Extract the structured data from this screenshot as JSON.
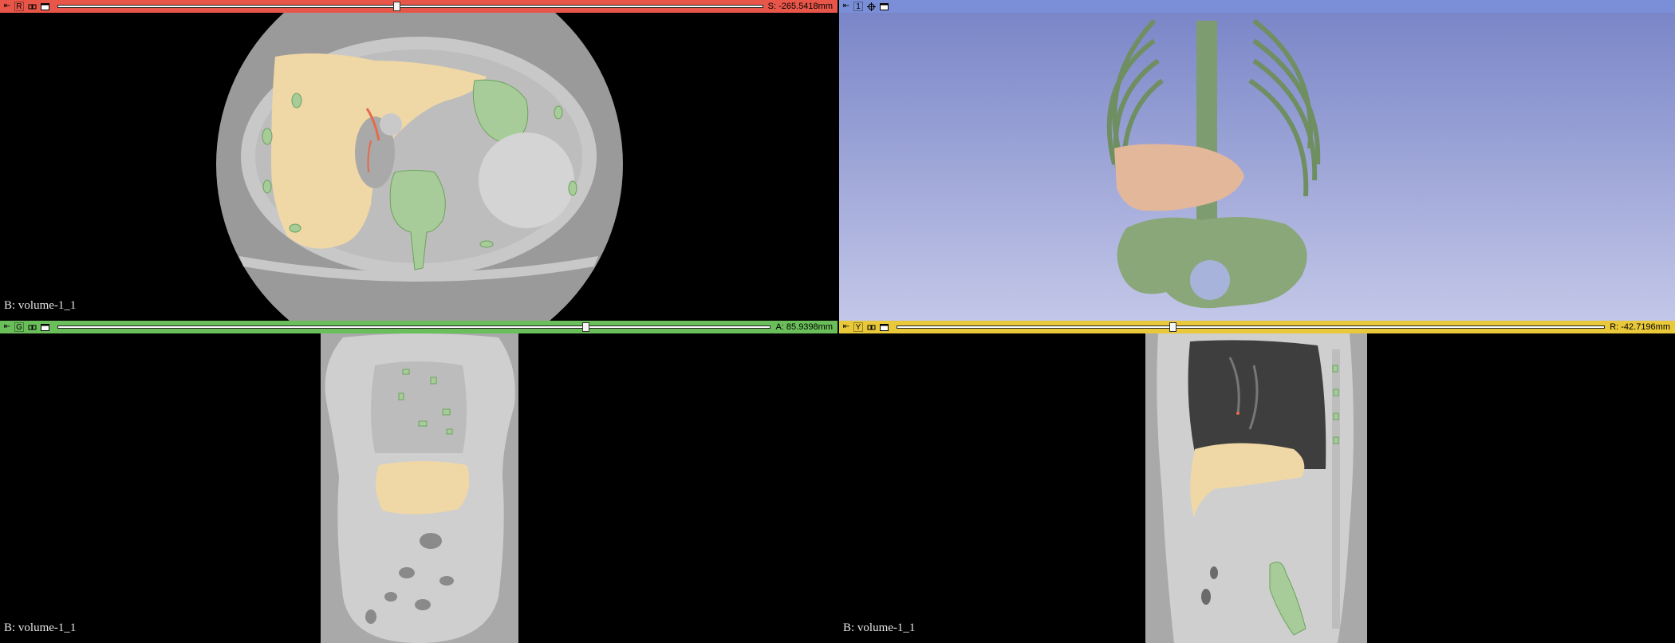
{
  "views": {
    "red": {
      "letter": "R",
      "coord": "S: -265.5418mm",
      "label": "B: volume-1_1",
      "slider_fraction": 0.48,
      "color": "#e8564a"
    },
    "threed": {
      "letter": "1",
      "color": "#7b8fd8"
    },
    "green": {
      "letter": "G",
      "coord": "A: 85.9398mm",
      "label": "B: volume-1_1",
      "slider_fraction": 0.74,
      "color": "#6bbf5a"
    },
    "yellow": {
      "letter": "Y",
      "coord": "R: -42.7196mm",
      "label": "B: volume-1_1",
      "slider_fraction": 0.39,
      "color": "#e9c93a"
    }
  },
  "icons": [
    "pin-icon",
    "link-icon",
    "window-icon",
    "crosshair-icon"
  ],
  "segment_colors": {
    "liver": "#f0d8a6",
    "bone": "#8fb87f",
    "marker": "#e66a4c"
  }
}
